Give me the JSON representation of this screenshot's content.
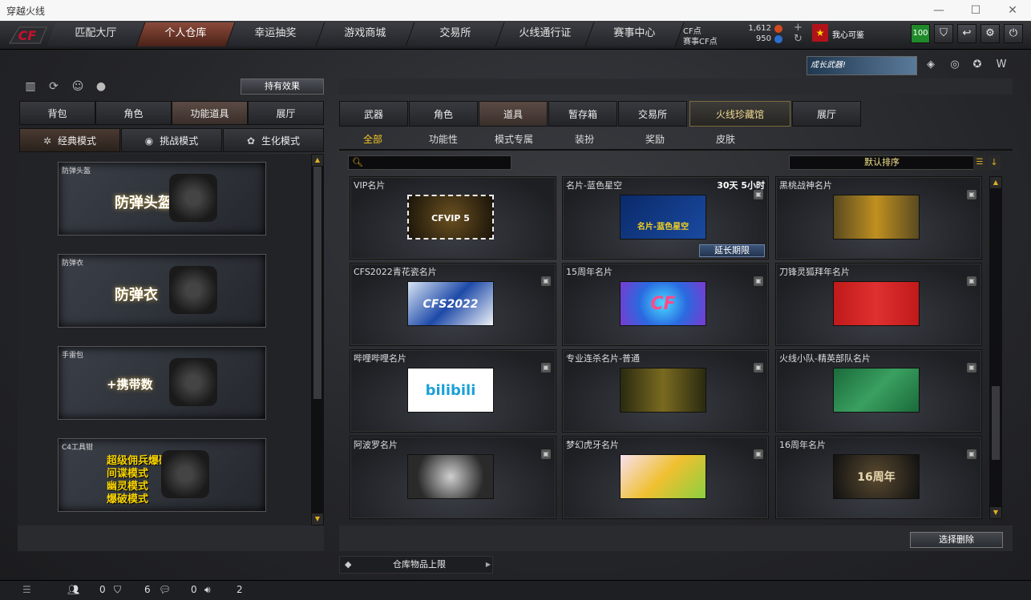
{
  "window": {
    "title": "穿越火线",
    "min": "—",
    "max": "☐",
    "close": "✕"
  },
  "logo": "CF",
  "topnav": [
    "匹配大厅",
    "个人仓库",
    "幸运抽奖",
    "游戏商城",
    "交易所",
    "火线通行证",
    "赛事中心"
  ],
  "topnav_active": 1,
  "points": {
    "cf_label": "CF点",
    "cf_value": "1,612",
    "match_label": "赛事CF点",
    "match_value": "950"
  },
  "user": {
    "name": "我心可鉴",
    "level": "100"
  },
  "banner": {
    "text": "成长武器!"
  },
  "left": {
    "effect_button": "持有效果",
    "tabs": [
      "背包",
      "角色",
      "功能道具",
      "展厅"
    ],
    "tabs_active": 2,
    "modes": [
      "经典模式",
      "挑战模式",
      "生化模式"
    ],
    "modes_active": 0,
    "items": [
      {
        "caption": "防弹头盔",
        "label": "防弹头盔"
      },
      {
        "caption": "防弹衣",
        "label": "防弹衣"
      },
      {
        "caption": "手雷包",
        "label": "+携带数"
      },
      {
        "caption": "C4工具钳",
        "modes": [
          "超级佣兵爆破",
          "间谍模式",
          "幽灵模式",
          "爆破模式"
        ]
      }
    ]
  },
  "right": {
    "tabs": [
      "武器",
      "角色",
      "道具",
      "暂存箱",
      "交易所",
      "火线珍藏馆",
      "展厅"
    ],
    "tabs_active": 2,
    "subtabs": [
      "全部",
      "功能性",
      "模式专属",
      "装扮",
      "奖励",
      "皮肤"
    ],
    "subtabs_active": 0,
    "search_placeholder": "",
    "sort_label": "默认排序",
    "cards": [
      {
        "name": "VIP名片",
        "art": "CFVIP 5"
      },
      {
        "name": "名片-蓝色星空",
        "time": "30天 5小时",
        "art": "名片-蓝色星空",
        "extend": "延长期限"
      },
      {
        "name": "黑桃战神名片",
        "art": ""
      },
      {
        "name": "CFS2022青花瓷名片",
        "art": "CFS2022"
      },
      {
        "name": "15周年名片",
        "art": "CF"
      },
      {
        "name": "刀锋灵狐拜年名片",
        "art": ""
      },
      {
        "name": "哔哩哔哩名片",
        "art": "bilibili"
      },
      {
        "name": "专业连杀名片-普通",
        "art": ""
      },
      {
        "name": "火线小队-精英部队名片",
        "art": ""
      },
      {
        "name": "阿波罗名片",
        "art": ""
      },
      {
        "name": "梦幻虎牙名片",
        "art": ""
      },
      {
        "name": "16周年名片",
        "art": "16周年"
      }
    ],
    "delete_button": "选择删除",
    "limit_label": "仓库物品上限"
  },
  "status": {
    "a": "0",
    "b": "6",
    "c": "0",
    "d": "2"
  },
  "colors": {
    "accent": "#f3c623",
    "active_tab": "#8a4a3a"
  }
}
